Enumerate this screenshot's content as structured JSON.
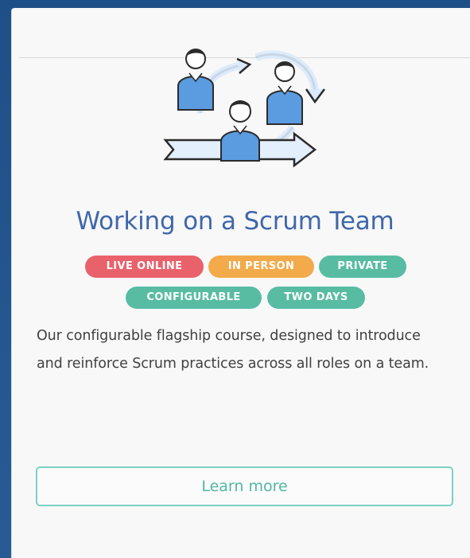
{
  "course": {
    "title": "Working on a Scrum Team",
    "description": "Our configurable flagship course, designed to introduce and reinforce Scrum practices across all roles on a team.",
    "tags": [
      {
        "label": "LIVE ONLINE",
        "color": "#e9626b"
      },
      {
        "label": "IN PERSON",
        "color": "#f2aa4a"
      },
      {
        "label": "PRIVATE",
        "color": "#58bca3"
      },
      {
        "label": "CONFIGURABLE",
        "color": "#58bca3"
      },
      {
        "label": "TWO DAYS",
        "color": "#58bca3"
      }
    ],
    "cta_label": "Learn more",
    "illustration_icon": "scrum-team-cycle-icon"
  }
}
